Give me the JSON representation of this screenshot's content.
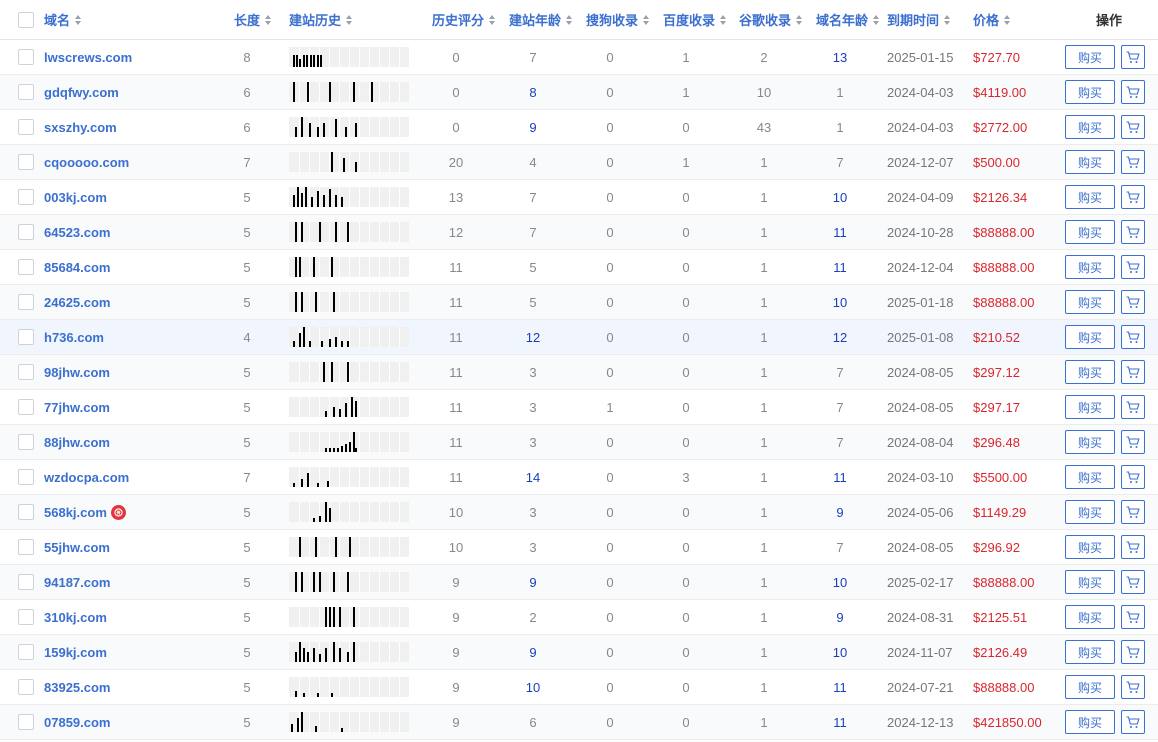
{
  "header": {
    "domain": "域名",
    "length": "长度",
    "history": "建站历史",
    "score": "历史评分",
    "build_age": "建站年龄",
    "sogou": "搜狗收录",
    "baidu": "百度收录",
    "google": "谷歌收录",
    "domain_age": "域名年龄",
    "expire": "到期时间",
    "price": "价格",
    "action": "操作"
  },
  "buy_label": "购买",
  "colors": {
    "accent": "#3b6fd0",
    "price": "#d9272e",
    "highlight_num": "#1a3fb8"
  },
  "rows": [
    {
      "domain": "lwscrews.com",
      "length": "8",
      "score": "0",
      "build_age": "7",
      "sogou": "0",
      "baidu": "1",
      "google": "2",
      "domain_age": "13",
      "expire": "2025-01-15",
      "price": "$727.70"
    },
    {
      "domain": "gdqfwy.com",
      "length": "6",
      "score": "0",
      "build_age": "8",
      "sogou": "0",
      "baidu": "1",
      "google": "10",
      "domain_age": "1",
      "expire": "2024-04-03",
      "price": "$4119.00"
    },
    {
      "domain": "sxszhy.com",
      "length": "6",
      "score": "0",
      "build_age": "9",
      "sogou": "0",
      "baidu": "0",
      "google": "43",
      "domain_age": "1",
      "expire": "2024-04-03",
      "price": "$2772.00"
    },
    {
      "domain": "cqooooo.com",
      "length": "7",
      "score": "20",
      "build_age": "4",
      "sogou": "0",
      "baidu": "1",
      "google": "1",
      "domain_age": "7",
      "expire": "2024-12-07",
      "price": "$500.00"
    },
    {
      "domain": "003kj.com",
      "length": "5",
      "score": "13",
      "build_age": "7",
      "sogou": "0",
      "baidu": "0",
      "google": "1",
      "domain_age": "10",
      "expire": "2024-04-09",
      "price": "$2126.34"
    },
    {
      "domain": "64523.com",
      "length": "5",
      "score": "12",
      "build_age": "7",
      "sogou": "0",
      "baidu": "0",
      "google": "1",
      "domain_age": "11",
      "expire": "2024-10-28",
      "price": "$88888.00"
    },
    {
      "domain": "85684.com",
      "length": "5",
      "score": "11",
      "build_age": "5",
      "sogou": "0",
      "baidu": "0",
      "google": "1",
      "domain_age": "11",
      "expire": "2024-12-04",
      "price": "$88888.00"
    },
    {
      "domain": "24625.com",
      "length": "5",
      "score": "11",
      "build_age": "5",
      "sogou": "0",
      "baidu": "0",
      "google": "1",
      "domain_age": "10",
      "expire": "2025-01-18",
      "price": "$88888.00"
    },
    {
      "domain": "h736.com",
      "length": "4",
      "score": "11",
      "build_age": "12",
      "sogou": "0",
      "baidu": "0",
      "google": "1",
      "domain_age": "12",
      "expire": "2025-01-08",
      "price": "$210.52"
    },
    {
      "domain": "98jhw.com",
      "length": "5",
      "score": "11",
      "build_age": "3",
      "sogou": "0",
      "baidu": "0",
      "google": "1",
      "domain_age": "7",
      "expire": "2024-08-05",
      "price": "$297.12"
    },
    {
      "domain": "77jhw.com",
      "length": "5",
      "score": "11",
      "build_age": "3",
      "sogou": "1",
      "baidu": "0",
      "google": "1",
      "domain_age": "7",
      "expire": "2024-08-05",
      "price": "$297.17"
    },
    {
      "domain": "88jhw.com",
      "length": "5",
      "score": "11",
      "build_age": "3",
      "sogou": "0",
      "baidu": "0",
      "google": "1",
      "domain_age": "7",
      "expire": "2024-08-04",
      "price": "$296.48"
    },
    {
      "domain": "wzdocpa.com",
      "length": "7",
      "score": "11",
      "build_age": "14",
      "sogou": "0",
      "baidu": "3",
      "google": "1",
      "domain_age": "11",
      "expire": "2024-03-10",
      "price": "$5500.00"
    },
    {
      "domain": "568kj.com",
      "length": "5",
      "score": "10",
      "build_age": "3",
      "sogou": "0",
      "baidu": "0",
      "google": "1",
      "domain_age": "9",
      "expire": "2024-05-06",
      "price": "$1149.29",
      "badge": "red-seal-icon"
    },
    {
      "domain": "55jhw.com",
      "length": "5",
      "score": "10",
      "build_age": "3",
      "sogou": "0",
      "baidu": "0",
      "google": "1",
      "domain_age": "7",
      "expire": "2024-08-05",
      "price": "$296.92"
    },
    {
      "domain": "94187.com",
      "length": "5",
      "score": "9",
      "build_age": "9",
      "sogou": "0",
      "baidu": "0",
      "google": "1",
      "domain_age": "10",
      "expire": "2025-02-17",
      "price": "$88888.00"
    },
    {
      "domain": "310kj.com",
      "length": "5",
      "score": "9",
      "build_age": "2",
      "sogou": "0",
      "baidu": "0",
      "google": "1",
      "domain_age": "9",
      "expire": "2024-08-31",
      "price": "$2125.51"
    },
    {
      "domain": "159kj.com",
      "length": "5",
      "score": "9",
      "build_age": "9",
      "sogou": "0",
      "baidu": "0",
      "google": "1",
      "domain_age": "10",
      "expire": "2024-11-07",
      "price": "$2126.49"
    },
    {
      "domain": "83925.com",
      "length": "5",
      "score": "9",
      "build_age": "10",
      "sogou": "0",
      "baidu": "0",
      "google": "1",
      "domain_age": "11",
      "expire": "2024-07-21",
      "price": "$88888.00"
    },
    {
      "domain": "07859.com",
      "length": "5",
      "score": "9",
      "build_age": "6",
      "sogou": "0",
      "baidu": "0",
      "google": "1",
      "domain_age": "11",
      "expire": "2024-12-13",
      "price": "$421850.00"
    }
  ]
}
